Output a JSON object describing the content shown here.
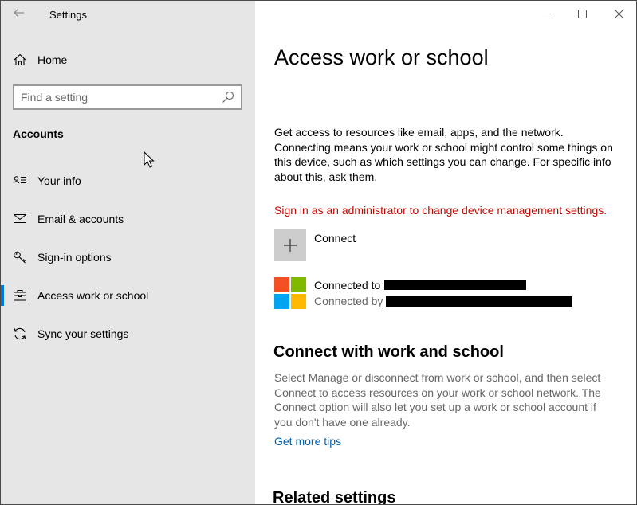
{
  "window": {
    "title": "Settings",
    "controls": [
      "minimize",
      "maximize",
      "close"
    ]
  },
  "sidebar": {
    "home_label": "Home",
    "search": {
      "placeholder": "Find a setting",
      "value": ""
    },
    "section_title": "Accounts",
    "items": [
      {
        "label": "Your info",
        "icon": "contact-card-icon",
        "selected": false
      },
      {
        "label": "Email & accounts",
        "icon": "mail-icon",
        "selected": false
      },
      {
        "label": "Sign-in options",
        "icon": "key-icon",
        "selected": false
      },
      {
        "label": "Access work or school",
        "icon": "briefcase-icon",
        "selected": true
      },
      {
        "label": "Sync your settings",
        "icon": "sync-icon",
        "selected": false
      }
    ]
  },
  "main": {
    "title": "Access work or school",
    "description": "Get access to resources like email, apps, and the network. Connecting means your work or school might control some things on this device, such as which settings you can change. For specific info about this, ask them.",
    "admin_message": "Sign in as an administrator to change device management settings.",
    "connect_label": "Connect",
    "account": {
      "line1": "Connected to",
      "line2": "Connected by"
    },
    "connect_section": {
      "title": "Connect with work and school",
      "description": "Select Manage or disconnect from work or school, and then select Connect to access resources on your work or school network. The Connect option will also let you set up a work or school account if you don't have one already.",
      "link": "Get more tips"
    },
    "related_title": "Related settings"
  },
  "colors": {
    "accent": "#0078d7",
    "error": "#c50500",
    "link": "#0063b1",
    "sidebar_bg": "#e6e6e6",
    "ms_red": "#f25022",
    "ms_green": "#7fba00",
    "ms_blue": "#00a4ef",
    "ms_yellow": "#ffb900"
  }
}
